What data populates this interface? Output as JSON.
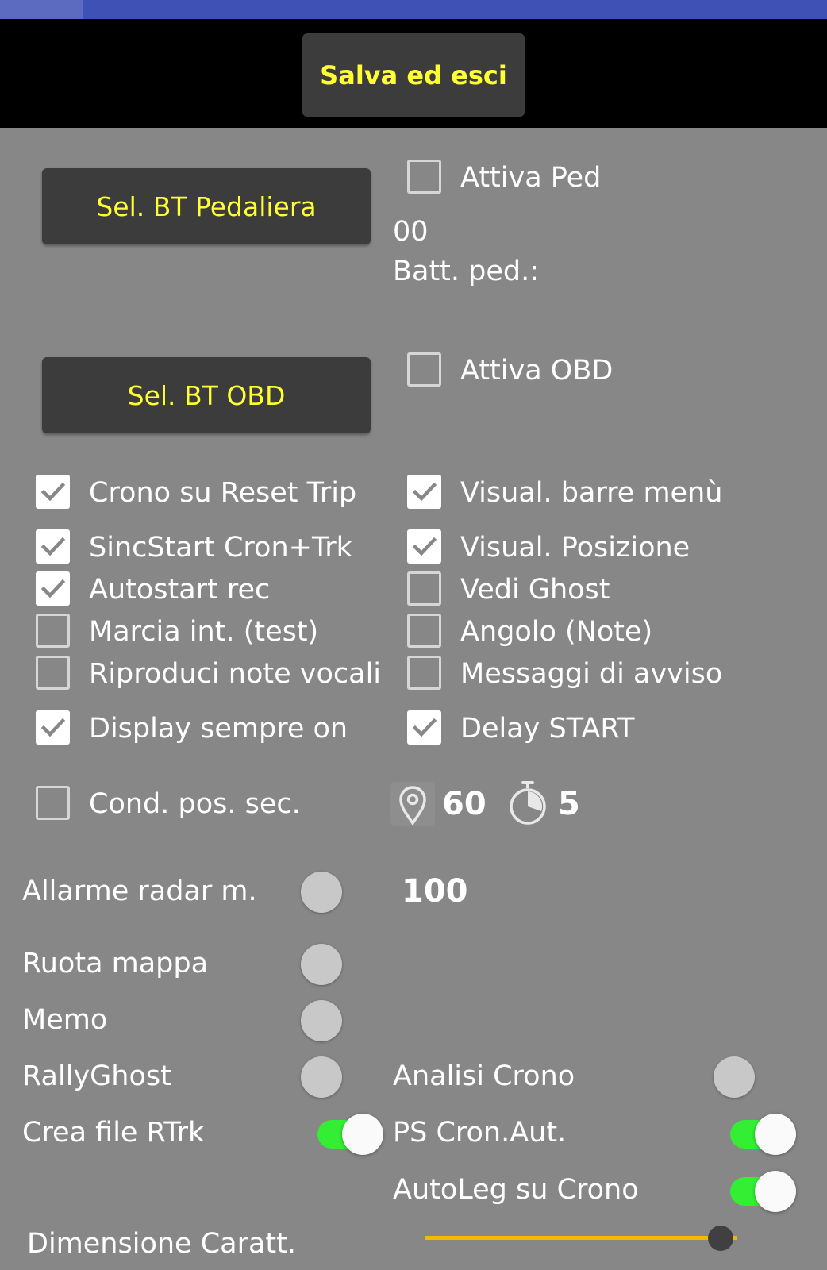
{
  "header": {
    "save_label": "Salva ed esci"
  },
  "buttons": {
    "bt_pedal": "Sel. BT Pedaliera",
    "bt_obd": "Sel. BT OBD"
  },
  "pedal": {
    "enable_label": "Attiva Ped",
    "enabled": false,
    "code": "00",
    "battery_label": "Batt. ped.:"
  },
  "obd": {
    "enable_label": "Attiva OBD",
    "enabled": false
  },
  "options_left": [
    {
      "label": "Crono su Reset Trip",
      "checked": true
    },
    {
      "label": "SincStart Cron+Trk",
      "checked": true
    },
    {
      "label": "Autostart rec",
      "checked": true
    },
    {
      "label": "Marcia int. (test)",
      "checked": false
    },
    {
      "label": "Riproduci note vocali",
      "checked": false
    },
    {
      "label": "Display sempre on",
      "checked": true
    },
    {
      "label": "Cond. pos. sec.",
      "checked": false
    }
  ],
  "options_right": [
    {
      "label": "Visual. barre menù",
      "checked": true
    },
    {
      "label": "Visual. Posizione",
      "checked": true
    },
    {
      "label": "Vedi Ghost",
      "checked": false
    },
    {
      "label": "Angolo (Note)",
      "checked": false
    },
    {
      "label": "Messaggi di avviso",
      "checked": false
    },
    {
      "label": "Delay START",
      "checked": true
    }
  ],
  "position": {
    "icon": "location-pin-icon",
    "value": "60"
  },
  "timer": {
    "icon": "stopwatch-icon",
    "value": "5"
  },
  "radar": {
    "label": "Allarme radar m.",
    "value": "100",
    "slider_position": 0
  },
  "ruota_mappa": {
    "label": "Ruota mappa"
  },
  "memo": {
    "label": "Memo"
  },
  "rallyghost": {
    "label": "RallyGhost"
  },
  "analisi_crono": {
    "label": "Analisi Crono"
  },
  "toggles": [
    {
      "label": "Crea file RTrk",
      "on": true
    },
    {
      "label": "PS Cron.Aut.",
      "on": true
    },
    {
      "label": "AutoLeg su Crono",
      "on": true
    }
  ],
  "font_size": {
    "label": "Dimensione Caratt.",
    "level": 0.95
  },
  "colors": {
    "accent_yellow": "#ffff33",
    "switch_on": "#33ee33",
    "slider_track": "#f5b800",
    "topbar": "#3f51b5"
  }
}
